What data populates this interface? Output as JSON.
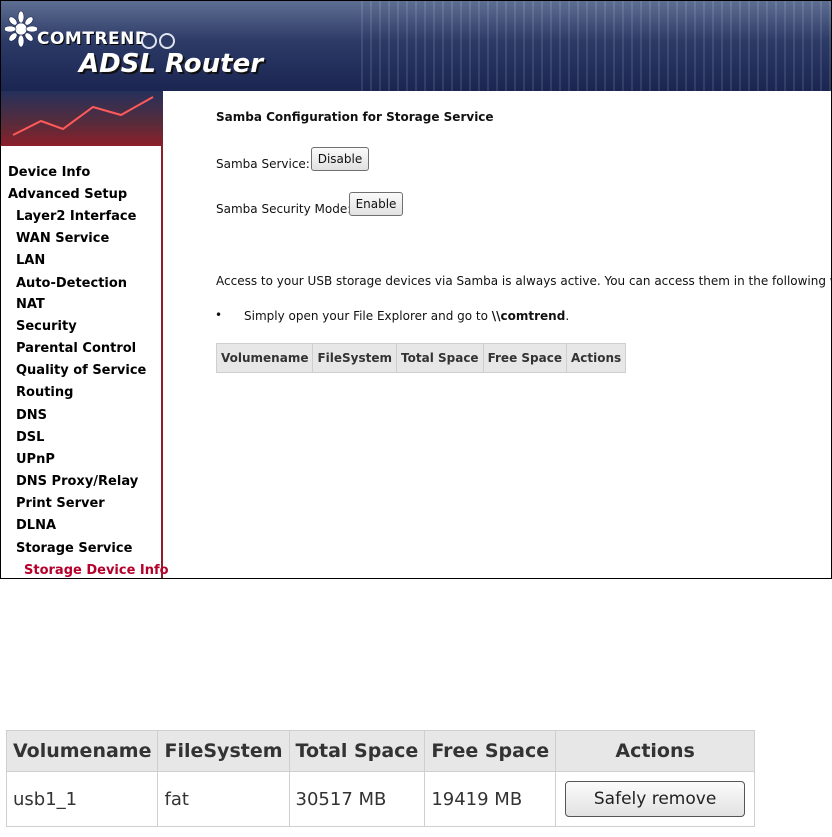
{
  "header": {
    "brand": "COMTREND",
    "product": "ADSL Router"
  },
  "sidebar": {
    "items": [
      {
        "label": "Device Info",
        "level": 0
      },
      {
        "label": "Advanced Setup",
        "level": 0
      },
      {
        "label": "Layer2 Interface",
        "level": 1
      },
      {
        "label": "WAN Service",
        "level": 1
      },
      {
        "label": "LAN",
        "level": 1
      },
      {
        "label": "Auto-Detection",
        "level": 1
      },
      {
        "label": "NAT",
        "level": 1
      },
      {
        "label": "Security",
        "level": 1
      },
      {
        "label": "Parental Control",
        "level": 1
      },
      {
        "label": "Quality of Service",
        "level": 1
      },
      {
        "label": "Routing",
        "level": 1
      },
      {
        "label": "DNS",
        "level": 1
      },
      {
        "label": "DSL",
        "level": 1
      },
      {
        "label": "UPnP",
        "level": 1
      },
      {
        "label": "DNS Proxy/Relay",
        "level": 1
      },
      {
        "label": "Print Server",
        "level": 1
      },
      {
        "label": "DLNA",
        "level": 1
      },
      {
        "label": "Storage Service",
        "level": 1
      },
      {
        "label": "Storage Device Info",
        "level": 2,
        "active": true
      }
    ]
  },
  "main": {
    "title": "Samba Configuration for Storage Service",
    "samba_service_label": "Samba Service:",
    "samba_service_button": "Disable",
    "security_mode_label": "Samba Security Mode:",
    "security_mode_button": "Enable",
    "access_text": "Access to your USB storage devices via Samba is always active. You can access them in the following ways:",
    "bullet_prefix": "Simply open your File Explorer and go to ",
    "bullet_path": "\\\\comtrend",
    "bullet_suffix": ".",
    "table_headers": [
      "Volumename",
      "FileSystem",
      "Total Space",
      "Free Space",
      "Actions"
    ]
  },
  "zoom_table": {
    "headers": [
      "Volumename",
      "FileSystem",
      "Total Space",
      "Free Space",
      "Actions"
    ],
    "rows": [
      {
        "volumename": "usb1_1",
        "filesystem": "fat",
        "total_space": "30517 MB",
        "free_space": "19419 MB",
        "action": "Safely remove"
      }
    ]
  },
  "colors": {
    "active_nav": "#b5002b",
    "accent_red": "#8d1f2a",
    "banner": "#1b2552"
  },
  "icons": {
    "logo": "globe-logo-icon",
    "bullet": "bullet-dot-icon"
  }
}
